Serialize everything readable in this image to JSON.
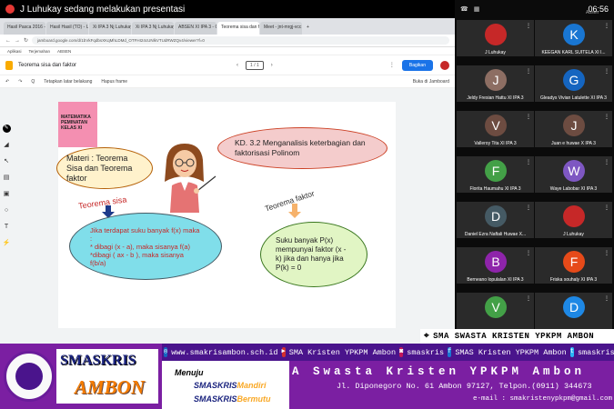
{
  "meet": {
    "presenting_banner": "J Luhukay sedang melakukan presentasi",
    "time": "06:56",
    "absen_label": "Absen"
  },
  "browser": {
    "tabs": [
      "Hasil Pasca 2016 - graded...",
      "Hasil Hasil (TO) - Untukyo...",
      "Xi IPA 3 Nj Luhukay 2/3/4/...",
      "Xi IPA 3 Nj Luhukay 2/3/4/...",
      "ABSEN XI IPA 3 - Google Form",
      "Teorema sisa dan faktor - Goo...",
      "Meet - jnt-mrgj-vcc",
      "+"
    ],
    "url": "jamboard.google.com/d/1bVkFqdbsXKqMhLDMd_OTFHI24cUNlkVTUdRWZQv4/viewer?f=0",
    "bookmarks": [
      "Aplikasi",
      "Terjemahan",
      "ABSEN"
    ]
  },
  "jamboard": {
    "doc_title": "Teorema sisa dan faktor",
    "frame_indicator": "1 / 1",
    "share_label": "Bagikan",
    "toolbar": {
      "set_bg": "Tetapkan latar belakang",
      "clear": "Hapus frame",
      "zoom": "Q",
      "present": "Buka di Jamboard"
    },
    "pink_note": "MATEMATIKA PEMINATAN KELAS XI",
    "materi": "Materi : Teorema Sisa dan Teorema faktor",
    "kd": "KD. 3.2 Menganalisis keterbagian dan faktorisasi Polinom",
    "label_sisa": "Teorema sisa",
    "label_faktor": "Teorema faktor",
    "sisa_text": "Jika terdapat suku banyak f(x) maka :\n* dibagi (x - a), maka sisanya f(a)\n*dibagi ( ax - b ), maka sisanya f(b/a)",
    "faktor_text": "Suku banyak P(x) mempunyai faktor (x - k) jika dan hanya jika P(k) = 0"
  },
  "participants": [
    {
      "name": "J Luhukay",
      "initial": "",
      "color": "#c62828",
      "self": true
    },
    {
      "name": "KEEGAN KARL SUITELA XI I...",
      "initial": "K",
      "color": "#1976d2"
    },
    {
      "name": "Jeldy Fresian Hattu XI IPA 3",
      "initial": "J",
      "color": "#8d6e63"
    },
    {
      "name": "Gleadys Vivian Latulette XI IPA 3",
      "initial": "G",
      "color": "#1565c0"
    },
    {
      "name": "Valleroy Tita XI IPA 3",
      "initial": "V",
      "color": "#6d4c41"
    },
    {
      "name": "Juan e huwae X IPA 3",
      "initial": "J",
      "color": "#6d4c41"
    },
    {
      "name": "Florita Haumahu XI IPA 3",
      "initial": "F",
      "color": "#43a047"
    },
    {
      "name": "Waye Labobar XI IPA 3",
      "initial": "W",
      "color": "#7e57c2"
    },
    {
      "name": "Daniel Ezra Naftali Huwae X...",
      "initial": "D",
      "color": "#455a64"
    },
    {
      "name": "J Luhukay",
      "initial": "",
      "color": "#c62828"
    },
    {
      "name": "Berneano lopulalan XI IPA 3",
      "initial": "B",
      "color": "#8e24aa"
    },
    {
      "name": "Friska souhaly XI IPA 3",
      "initial": "F",
      "color": "#e64a19"
    },
    {
      "name": "",
      "initial": "V",
      "color": "#43a047"
    },
    {
      "name": "",
      "initial": "D",
      "color": "#1e88e5"
    }
  ],
  "banner": {
    "tag": "SMA SWASTA KRISTEN YPKPM AMBON",
    "logo_line1": "SMASKRIS",
    "logo_line2": "AMBON",
    "website": "www.smakrisambon.sch.id",
    "youtube": "SMA Kristen YPKPM Ambon",
    "instagram": "smaskris",
    "facebook": "SMAS Kristen YPKPM Ambon",
    "twitter": "smaskris",
    "motto1": "Menuju",
    "motto2a": "SMASKRIS",
    "motto2b": "Mandiri",
    "motto3a": "SMASKRIS",
    "motto3b": "Bermutu",
    "school_name": "SMA Swasta Kristen YPKPM Ambon",
    "address": "Jl. Diponegoro  No. 61 Ambon 97127, Telpon.(0911) 344673",
    "email": "e-mail : smakristenypkpm@gmail.com"
  }
}
